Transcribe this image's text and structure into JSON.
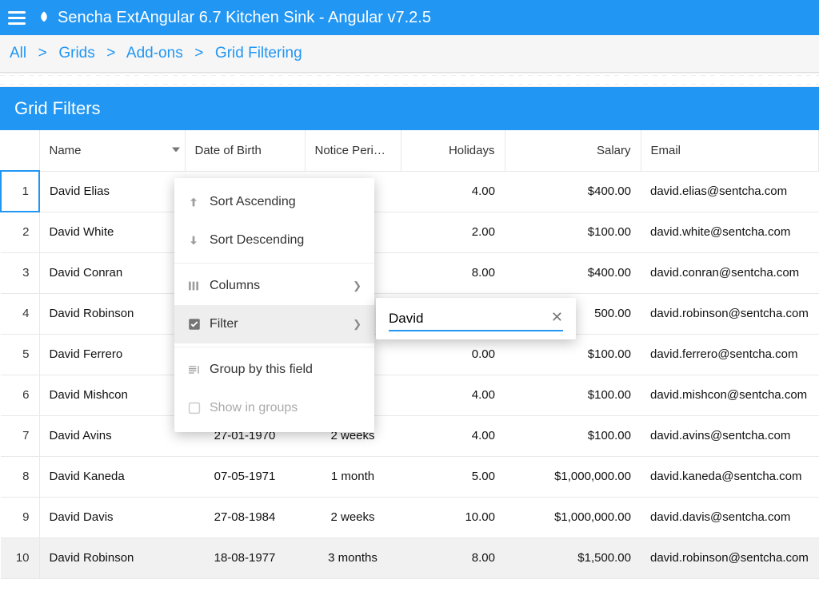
{
  "header": {
    "title": "Sencha ExtAngular 6.7 Kitchen Sink - Angular v7.2.5"
  },
  "breadcrumb": {
    "items": [
      "All",
      "Grids",
      "Add-ons",
      "Grid Filtering"
    ]
  },
  "panel": {
    "title": "Grid Filters"
  },
  "columns": {
    "name": "Name",
    "dob": "Date of Birth",
    "notice": "Notice Peri…",
    "holidays": "Holidays",
    "salary": "Salary",
    "email": "Email"
  },
  "rows": [
    {
      "n": "1",
      "name": "David Elias",
      "dob": "",
      "notice": "",
      "holidays": "4.00",
      "salary": "$400.00",
      "email": "david.elias@sentcha.com"
    },
    {
      "n": "2",
      "name": "David White",
      "dob": "",
      "notice": "",
      "holidays": "2.00",
      "salary": "$100.00",
      "email": "david.white@sentcha.com"
    },
    {
      "n": "3",
      "name": "David Conran",
      "dob": "",
      "notice": "",
      "holidays": "8.00",
      "salary": "$400.00",
      "email": "david.conran@sentcha.com"
    },
    {
      "n": "4",
      "name": "David Robinson",
      "dob": "",
      "notice": "",
      "holidays": "",
      "salary": "500.00",
      "email": "david.robinson@sentcha.com"
    },
    {
      "n": "5",
      "name": "David Ferrero",
      "dob": "",
      "notice": "",
      "holidays": "0.00",
      "salary": "$100.00",
      "email": "david.ferrero@sentcha.com"
    },
    {
      "n": "6",
      "name": "David Mishcon",
      "dob": "",
      "notice": "",
      "holidays": "4.00",
      "salary": "$100.00",
      "email": "david.mishcon@sentcha.com"
    },
    {
      "n": "7",
      "name": "David Avins",
      "dob": "27-01-1970",
      "notice": "2 weeks",
      "holidays": "4.00",
      "salary": "$100.00",
      "email": "david.avins@sentcha.com"
    },
    {
      "n": "8",
      "name": "David Kaneda",
      "dob": "07-05-1971",
      "notice": "1 month",
      "holidays": "5.00",
      "salary": "$1,000,000.00",
      "email": "david.kaneda@sentcha.com"
    },
    {
      "n": "9",
      "name": "David Davis",
      "dob": "27-08-1984",
      "notice": "2 weeks",
      "holidays": "10.00",
      "salary": "$1,000,000.00",
      "email": "david.davis@sentcha.com"
    },
    {
      "n": "10",
      "name": "David Robinson",
      "dob": "18-08-1977",
      "notice": "3 months",
      "holidays": "8.00",
      "salary": "$1,500.00",
      "email": "david.robinson@sentcha.com"
    }
  ],
  "menu": {
    "sort_asc": "Sort Ascending",
    "sort_desc": "Sort Descending",
    "columns": "Columns",
    "filter": "Filter",
    "group_by": "Group by this field",
    "show_groups": "Show in groups"
  },
  "filter": {
    "value": "David"
  }
}
